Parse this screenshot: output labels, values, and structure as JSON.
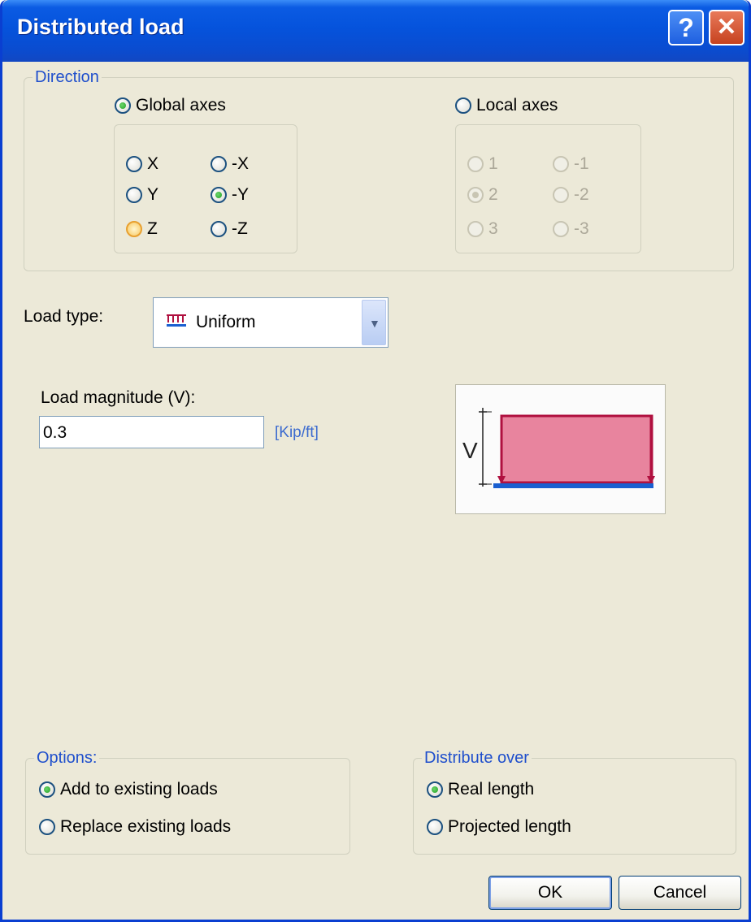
{
  "window": {
    "title": "Distributed load"
  },
  "direction": {
    "legend": "Direction",
    "global_label": "Global axes",
    "local_label": "Local axes",
    "global_axes": [
      "X",
      "-X",
      "Y",
      "-Y",
      "Z",
      "-Z"
    ],
    "global_selected": "-Y",
    "local_axes": [
      "1",
      "-1",
      "2",
      "-2",
      "3",
      "-3"
    ],
    "local_selected": "2",
    "selected_system": "Global axes"
  },
  "load_type": {
    "label": "Load type:",
    "value": "Uniform"
  },
  "magnitude": {
    "label": "Load magnitude (V):",
    "value": "0.3",
    "unit": "[Kip/ft]"
  },
  "diagram": {
    "symbol": "V"
  },
  "options": {
    "legend": "Options:",
    "items": [
      "Add to existing loads",
      "Replace existing loads"
    ],
    "selected": "Add to existing loads"
  },
  "distribute": {
    "legend": "Distribute over",
    "items": [
      "Real length",
      "Projected length"
    ],
    "selected": "Real length"
  },
  "buttons": {
    "ok": "OK",
    "cancel": "Cancel"
  },
  "colors": {
    "title_bar": "#0553dc",
    "load_fill": "#e8849e",
    "load_stroke": "#b0103f",
    "beam": "#1a5fd0",
    "link": "#3c6bcf"
  }
}
